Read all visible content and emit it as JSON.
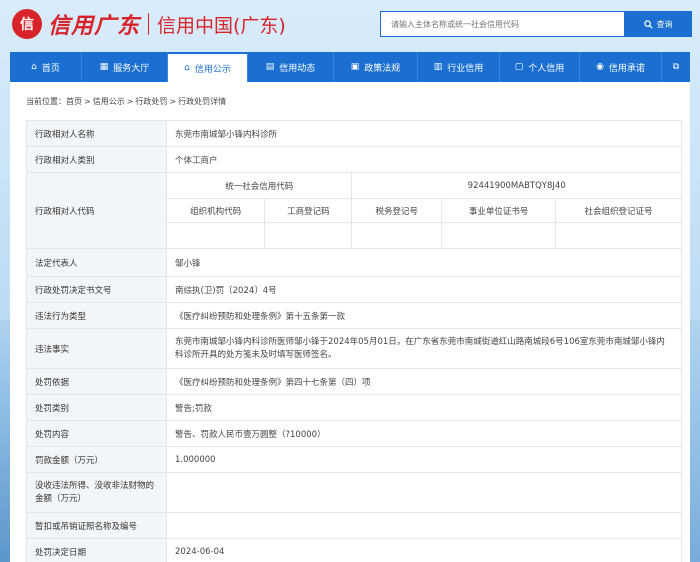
{
  "header": {
    "logo_mark": "信",
    "logo_script": "信用广东",
    "site_title": "信用中国(广东)",
    "search_placeholder": "请输入主体名称或统一社会信用代码",
    "search_button": "查询"
  },
  "nav": {
    "items": [
      {
        "icon": "home-icon",
        "glyph": "⌂",
        "label": "首页"
      },
      {
        "icon": "grid-icon",
        "glyph": "▦",
        "label": "服务大厅"
      },
      {
        "icon": "bank-icon",
        "glyph": "⌂",
        "label": "信用公示"
      },
      {
        "icon": "news-icon",
        "glyph": "▤",
        "label": "信用动态"
      },
      {
        "icon": "doc-icon",
        "glyph": "▣",
        "label": "政策法规"
      },
      {
        "icon": "book-icon",
        "glyph": "▥",
        "label": "行业信用"
      },
      {
        "icon": "person-icon",
        "glyph": "▢",
        "label": "个人信用"
      },
      {
        "icon": "pledge-icon",
        "glyph": "◉",
        "label": "信用承诺"
      },
      {
        "icon": "share-icon",
        "glyph": "⧉",
        "label": ""
      }
    ],
    "active_index": 2
  },
  "breadcrumb": {
    "prefix": "当前位置：",
    "items": [
      "首页",
      "信用公示",
      "行政处罚",
      "行政处罚详情"
    ]
  },
  "details": {
    "entity_name_label": "行政相对人名称",
    "entity_name": "东莞市南城邹小锋内科诊所",
    "entity_type_label": "行政相对人类别",
    "entity_type": "个体工商户",
    "entity_code_label": "行政相对人代码",
    "usci_label": "统一社会信用代码",
    "usci_value": "92441900MABTQY8J40",
    "sub_codes": [
      "组织机构代码",
      "工商登记码",
      "税务登记号",
      "事业单位证书号",
      "社会组织登记证号"
    ],
    "legal_rep_label": "法定代表人",
    "legal_rep": "邹小锋",
    "decision_no_label": "行政处罚决定书文号",
    "decision_no": "南综执(卫)罚〔2024〕4号",
    "violation_type_label": "违法行为类型",
    "violation_type": "《医疗纠纷预防和处理条例》第十五条第一款",
    "violation_fact_label": "违法事实",
    "violation_fact": "东莞市南城邹小锋内科诊所医师邹小锋于2024年05月01日，在广东省东莞市南城街道红山路南城段6号106室东莞市南城邹小锋内科诊所开具的处方笺未及时填写医师签名。",
    "basis_label": "处罚依据",
    "basis": "《医疗纠纷预防和处理条例》第四十七条第（四）项",
    "category_label": "处罚类别",
    "category": "警告;罚款",
    "content_label": "处罚内容",
    "content": "警告、罚款人民币壹万圆整（?10000）",
    "fine_label": "罚款金额（万元）",
    "fine": "1.000000",
    "confiscate_label": "没收违法所得、没收非法财物的金额（万元）",
    "confiscate": "",
    "suspend_label": "暂扣或吊销证照名称及编号",
    "suspend": "",
    "date_label": "处罚决定日期",
    "date": "2024-06-04"
  },
  "colors": {
    "brand_red": "#d9232a",
    "brand_blue": "#1b6fd0"
  }
}
